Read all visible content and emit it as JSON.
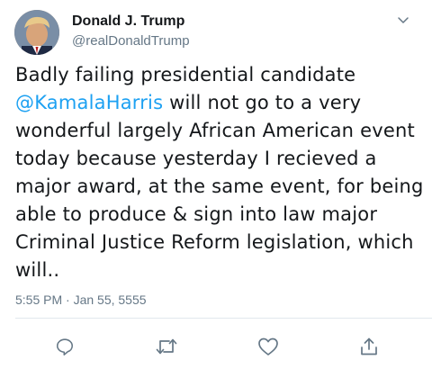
{
  "author": {
    "display_name": "Donald J. Trump",
    "handle": "@realDonaldTrump",
    "avatar_icon": "profile-photo"
  },
  "tweet": {
    "text_before_mention": "Badly failing presidential candidate",
    "mention": "@KamalaHarris",
    "text_after_mention": " will not go to a very wonderful largely African American event today because yesterday I recieved a major award, at the same event, for being able to produce & sign into law major Criminal Justice Reform legislation, which will..",
    "timestamp": "5:55 PM · Jan 55, 5555"
  },
  "actions": [
    {
      "name": "reply",
      "icon": "speech-bubble-icon"
    },
    {
      "name": "retweet",
      "icon": "retweet-arrows-icon"
    },
    {
      "name": "like",
      "icon": "heart-icon"
    },
    {
      "name": "share",
      "icon": "share-upload-icon"
    }
  ],
  "colors": {
    "text": "#14171a",
    "secondary": "#657786",
    "link": "#1da1f2",
    "divider": "#e1e8ed"
  }
}
